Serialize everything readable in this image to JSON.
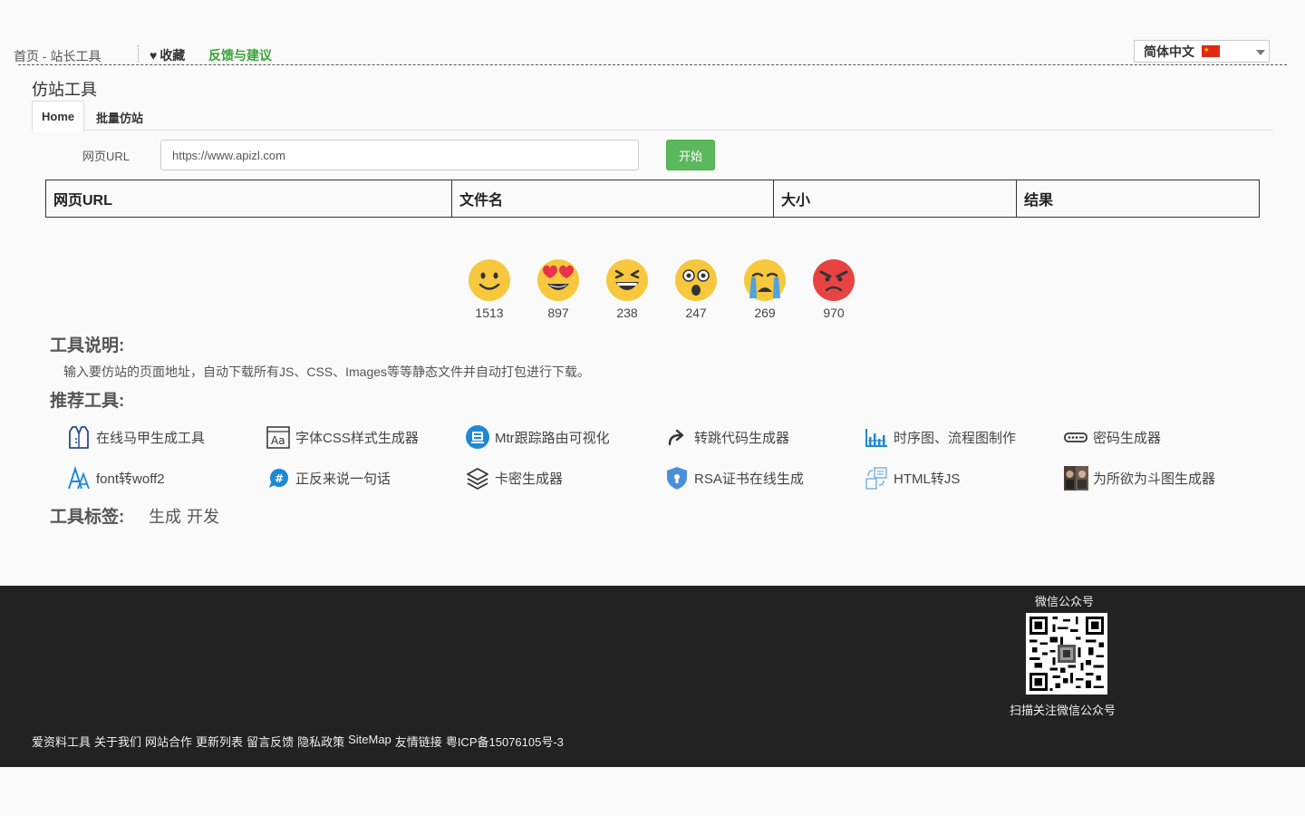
{
  "header": {
    "breadcrumb": "首页 - 站长工具",
    "favorite_label": "收藏",
    "feedback_label": "反馈与建议",
    "language": "简体中文"
  },
  "page": {
    "title": "仿站工具",
    "tabs": [
      {
        "label": "Home"
      },
      {
        "label": "批量仿站"
      }
    ]
  },
  "form": {
    "url_label": "网页URL",
    "url_value": "https://www.apizl.com",
    "start_label": "开始"
  },
  "table": {
    "headers": [
      "网页URL",
      "文件名",
      "大小",
      "结果"
    ]
  },
  "reactions": [
    {
      "icon": "smile-emoji-icon",
      "count": "1513"
    },
    {
      "icon": "heart-eyes-emoji-icon",
      "count": "897"
    },
    {
      "icon": "laughing-emoji-icon",
      "count": "238"
    },
    {
      "icon": "surprised-emoji-icon",
      "count": "247"
    },
    {
      "icon": "crying-emoji-icon",
      "count": "269"
    },
    {
      "icon": "angry-emoji-icon",
      "count": "970"
    }
  ],
  "description": {
    "heading": "工具说明:",
    "text": "输入要仿站的页面地址，自动下载所有JS、CSS、Images等等静态文件并自动打包进行下载。"
  },
  "recommended": {
    "heading": "推荐工具:",
    "tools": [
      {
        "label": "在线马甲生成工具",
        "icon": "vest-icon"
      },
      {
        "label": "字体CSS样式生成器",
        "icon": "font-aa-icon"
      },
      {
        "label": "Mtr跟踪路由可视化",
        "icon": "route-icon"
      },
      {
        "label": "转跳代码生成器",
        "icon": "redirect-arrow-icon"
      },
      {
        "label": "时序图、流程图制作",
        "icon": "timeline-chart-icon"
      },
      {
        "label": "密码生成器",
        "icon": "password-key-icon"
      },
      {
        "label": "font转woff2",
        "icon": "font-a-icon"
      },
      {
        "label": "正反来说一句话",
        "icon": "chat-hash-icon"
      },
      {
        "label": "卡密生成器",
        "icon": "layers-icon"
      },
      {
        "label": "RSA证书在线生成",
        "icon": "shield-icon"
      },
      {
        "label": "HTML转JS",
        "icon": "convert-icon"
      },
      {
        "label": "为所欲为斗图生成器",
        "icon": "meme-photo-icon"
      }
    ]
  },
  "tags": {
    "heading": "工具标签:",
    "items": [
      "生成",
      "开发"
    ]
  },
  "footer": {
    "wechat_title": "微信公众号",
    "wechat_sub": "扫描关注微信公众号",
    "links": [
      "爱资料工具",
      "关于我们",
      "网站合作",
      "更新列表",
      "留言反馈",
      "隐私政策",
      "SiteMap",
      "友情链接",
      "粤ICP备15076105号-3"
    ]
  },
  "colors": {
    "accent_green": "#5cb85c",
    "feedback_green": "#3aa13a",
    "footer_bg": "#222222"
  }
}
